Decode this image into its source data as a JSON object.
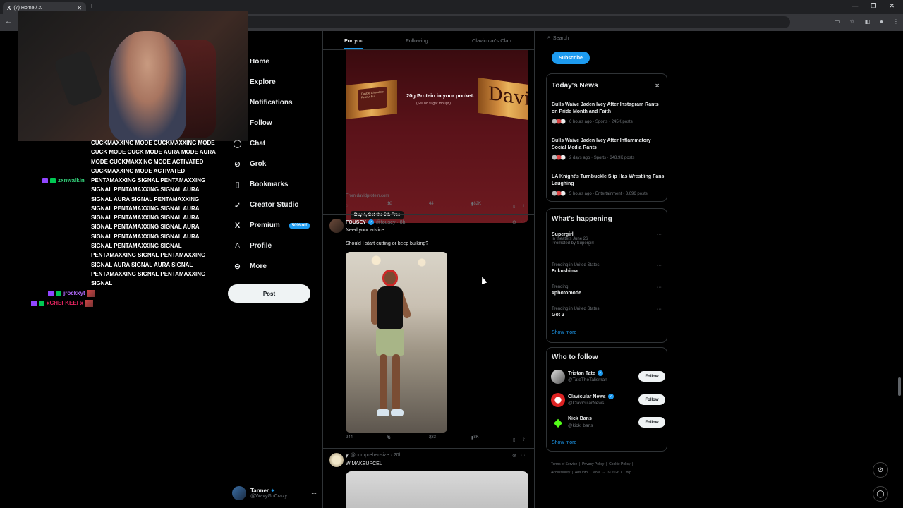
{
  "browser": {
    "tab_title": "(7) Home / X",
    "tab_logo": "X",
    "close_glyph": "✕",
    "new_tab_glyph": "+",
    "back_glyph": "←"
  },
  "chat": {
    "message_lines": [
      "CUCKMAXXING MODE CUCKMAXXING MODE",
      "CUCK MODE CUCK MODE AURA MODE AURA",
      "MODE CUCKMAXXING MODE ACTIVATED",
      "CUCKMAXXING MODE ACTIVATED"
    ],
    "user2": "zxnwalkin",
    "user2_lines": [
      "PENTAMAXXING SIGNAL PENTAMAXXING",
      "SIGNAL PENTAMAXXING SIGNAL AURA",
      "SIGNAL AURA SIGNAL PENTAMAXXING",
      "SIGNAL PENTAMAXXING SIGNAL AURA",
      "SIGNAL PENTAMAXXING SIGNAL AURA",
      "SIGNAL PENTAMAXXING SIGNAL AURA",
      "SIGNAL PENTAMAXXING SIGNAL AURA",
      "SIGNAL PENTAMAXXING SIGNAL",
      "PENTAMAXXING SIGNAL PENTAMAXXING",
      "SIGNAL AURA SIGNAL AURA SIGNAL",
      "PENTAMAXXING SIGNAL PENTAMAXXING",
      "SIGNAL"
    ],
    "user3": "jrockkyt",
    "user4": "xCHEFKEEFx"
  },
  "nav": {
    "home": "Home",
    "explore": "Explore",
    "notifications": "Notifications",
    "follow": "Follow",
    "chat": "Chat",
    "grok": "Grok",
    "bookmarks": "Bookmarks",
    "creator_studio": "Creator Studio",
    "premium": "Premium",
    "premium_badge": "50% off",
    "profile": "Profile",
    "more": "More",
    "post": "Post"
  },
  "account": {
    "name": "Tanner",
    "handle": "@WavyGoCrazy",
    "more": "···"
  },
  "timeline": {
    "tabs": [
      "For you",
      "Following",
      "Clavicular's Clan"
    ],
    "ad": {
      "headline": "20g Protein in your pocket.",
      "subline": "(Still no sugar though)",
      "wrapper_text": "Double Chocolate Peanut Bu",
      "brand_text": "Davi",
      "brand_text_left": "d",
      "cta": "Buy 4, Get the 5th Free",
      "source": "From davidprotein.com",
      "retweets": "10",
      "likes": "44",
      "views": "482K"
    },
    "tweet1": {
      "name": "FOUSEY",
      "handle": "@fousey · 8h",
      "line1": "Need your advice..",
      "line2": "Should I start cutting or keep bulking?",
      "replies": "244",
      "retweets": "5",
      "likes": "233",
      "views": "78K"
    },
    "tweet2": {
      "name": "y",
      "handle": "@comprehensize · 20h",
      "text": "W MAKEUPCEL"
    }
  },
  "sidebar": {
    "search_placeholder": "Search",
    "subscribe": "Subscribe",
    "news_title": "Today's News",
    "close": "✕",
    "news": [
      {
        "title": "Bulls Waive Jaden Ivey After Instagram Rants on Pride Month and Faith",
        "meta": "6 hours ago · Sports · 245K posts"
      },
      {
        "title": "Bulls Waive Jaden Ivey After Inflammatory Social Media Rants",
        "meta": "2 days ago · Sports · 348.9K posts"
      },
      {
        "title": "LA Knight's Turnbuckle Slip Has Wrestling Fans Laughing",
        "meta": "5 hours ago · Entertainment · 3,696 posts"
      }
    ],
    "happening_title": "What's happening",
    "trends": [
      {
        "ctx": "",
        "name": "Supergirl",
        "sub1": "In theaters June 26",
        "sub2": "Promoted by Supergirl"
      },
      {
        "ctx": "Trending in United States",
        "name": "Fukushima"
      },
      {
        "ctx": "Trending",
        "name": "#photomode"
      },
      {
        "ctx": "Trending in United States",
        "name": "Got 2"
      }
    ],
    "show_more": "Show more",
    "who_title": "Who to follow",
    "who": [
      {
        "name": "Tristan Tate",
        "handle": "@TateTheTalisman"
      },
      {
        "name": "Clavicular News",
        "handle": "@ClavicularNews"
      },
      {
        "name": "Kick Bans",
        "handle": "@kick_bans"
      }
    ],
    "follow": "Follow",
    "footer": [
      "Terms of Service",
      "Privacy Policy",
      "Cookie Policy",
      "Accessibility",
      "Ads info",
      "More ···",
      "© 2026 X Corp."
    ]
  }
}
